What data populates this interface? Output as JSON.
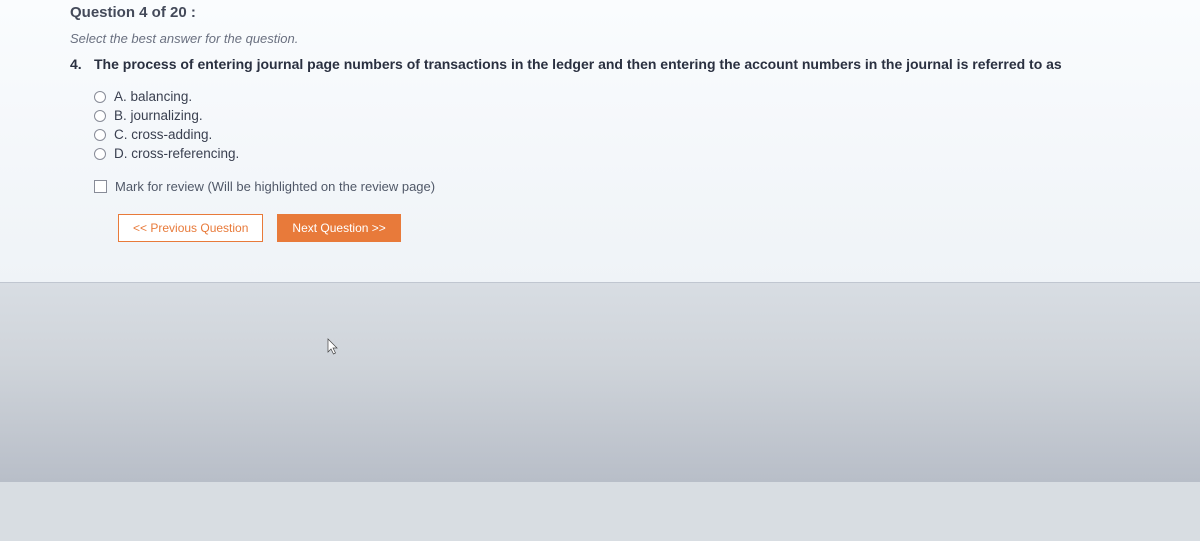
{
  "header": {
    "counter": "Question 4 of 20 :"
  },
  "instruction": "Select the best answer for the question.",
  "question": {
    "number": "4.",
    "text": "The process of entering journal page numbers of transactions in the ledger and then entering the account numbers in the journal is referred to as"
  },
  "answers": [
    {
      "letter": "A.",
      "text": "balancing."
    },
    {
      "letter": "B.",
      "text": "journalizing."
    },
    {
      "letter": "C.",
      "text": "cross-adding."
    },
    {
      "letter": "D.",
      "text": "cross-referencing."
    }
  ],
  "review": {
    "label": "Mark for review (Will be highlighted on the review page)"
  },
  "nav": {
    "prev": "<< Previous Question",
    "next": "Next Question >>"
  }
}
